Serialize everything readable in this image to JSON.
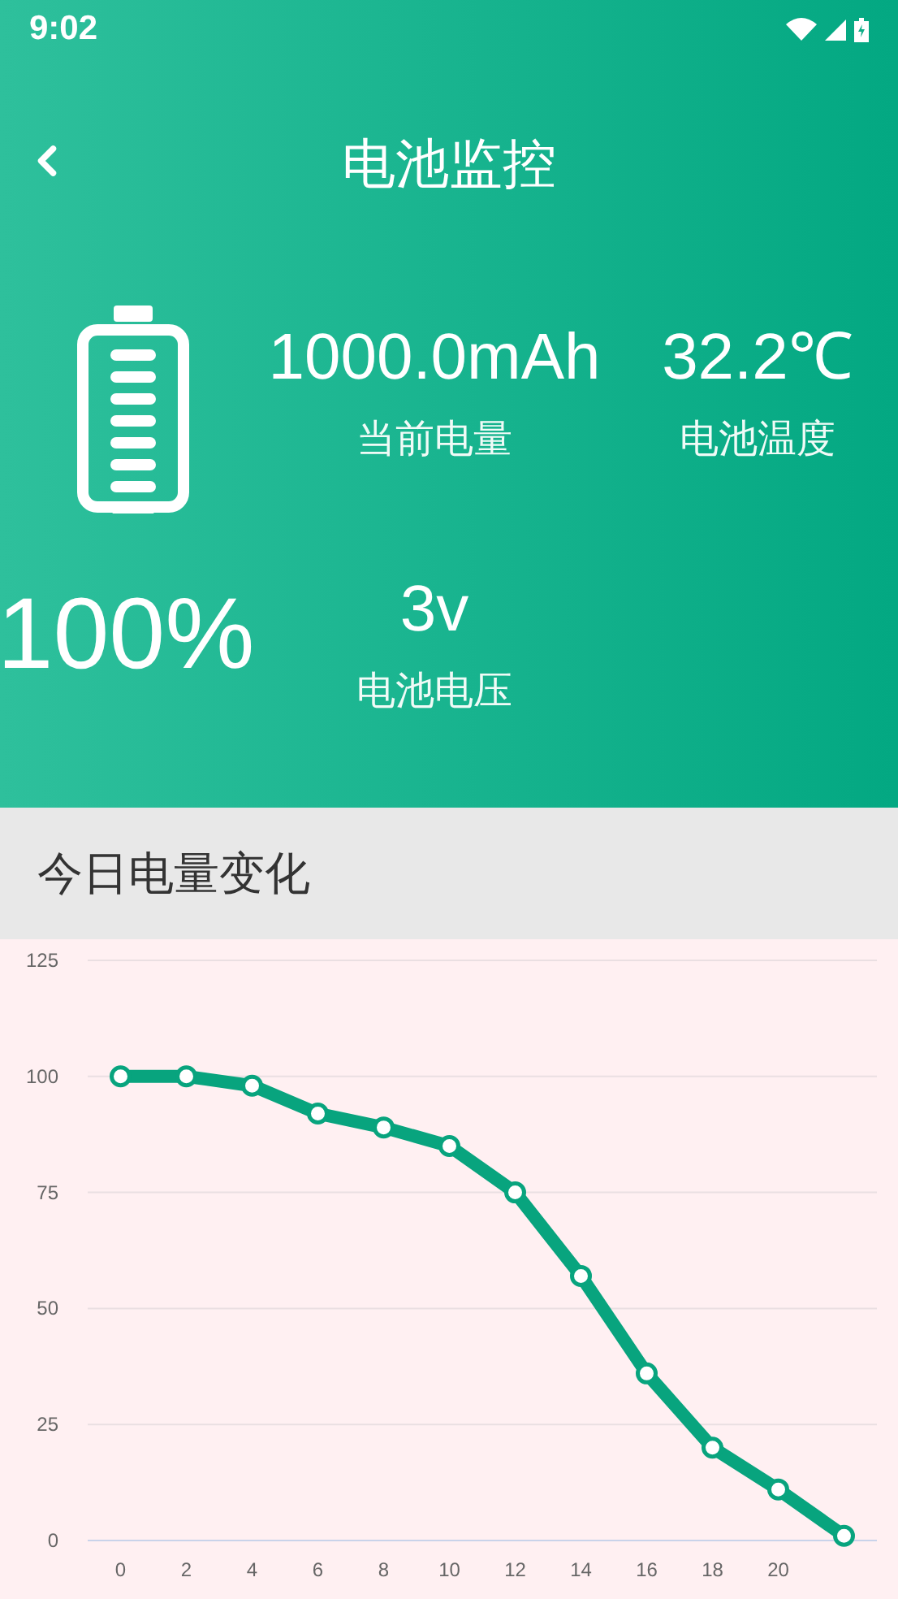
{
  "status_bar": {
    "time": "9:02"
  },
  "header": {
    "title": "电池监控"
  },
  "battery": {
    "percent": "100%"
  },
  "stats": [
    {
      "value": "1000.0mAh",
      "label": "当前电量"
    },
    {
      "value": "32.2℃",
      "label": "电池温度"
    },
    {
      "value": "3v",
      "label": "电池电压"
    }
  ],
  "section": {
    "title": "今日电量变化"
  },
  "chart": {
    "chart_data": {
      "type": "line",
      "x": [
        0,
        2,
        4,
        6,
        8,
        10,
        12,
        14,
        16,
        18,
        20,
        22
      ],
      "grid": true,
      "series": [
        {
          "marker": true,
          "color": "#08a47e",
          "values": [
            100,
            100,
            98,
            92,
            89,
            85,
            75,
            57,
            36,
            20,
            11,
            1
          ]
        }
      ],
      "ylim": [
        0,
        125
      ],
      "yticks": [
        0,
        25,
        50,
        75,
        100,
        125
      ],
      "xticks": [
        0,
        2,
        4,
        6,
        8,
        10,
        12,
        14,
        16,
        18,
        20
      ],
      "xlim": [
        -1,
        23
      ]
    }
  }
}
